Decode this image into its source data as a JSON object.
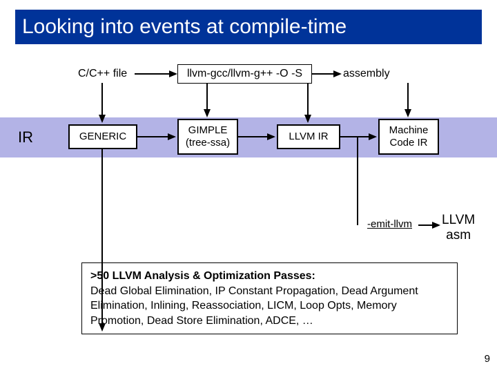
{
  "title": "Looking into events at compile-time",
  "top": {
    "source_label": "C/C++ file",
    "compiler_box": "llvm-gcc/llvm-g++ -O -S",
    "assembly_label": "assembly"
  },
  "ir_label": "IR",
  "ir_boxes": {
    "generic": "GENERIC",
    "gimple_l1": "GIMPLE",
    "gimple_l2": "(tree-ssa)",
    "llvm_ir": "LLVM IR",
    "machine_l1": "Machine",
    "machine_l2": "Code IR"
  },
  "emit_flag": "-emit-llvm",
  "llvm_asm_l1": "LLVM",
  "llvm_asm_l2": "asm",
  "passes": {
    "title": ">50 LLVM Analysis & Optimization Passes:",
    "body": "Dead Global Elimination, IP Constant Propagation, Dead Argument Elimination, Inlining, Reassociation, LICM, Loop Opts, Memory Promotion, Dead Store Elimination, ADCE, …"
  },
  "slide_number": "9"
}
